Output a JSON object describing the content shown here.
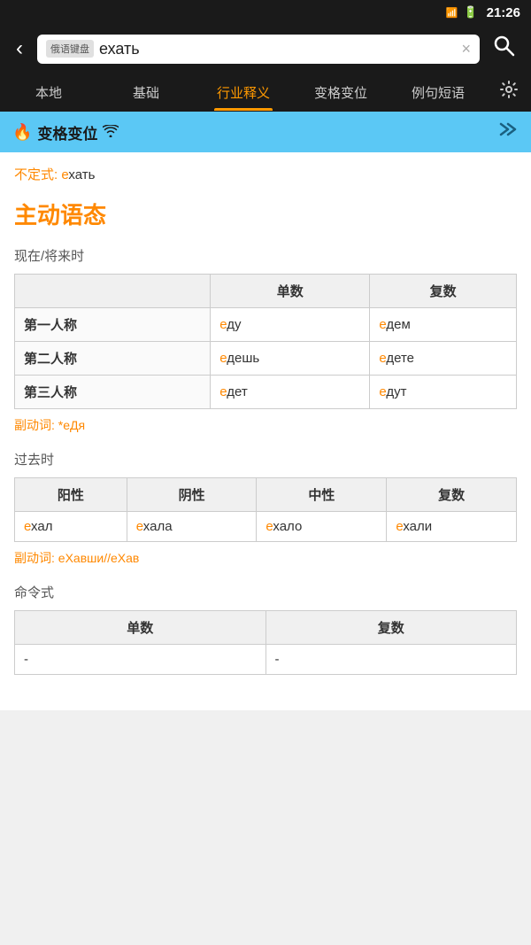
{
  "statusBar": {
    "time": "21:26",
    "signals": "4G/2G"
  },
  "searchBar": {
    "backLabel": "‹",
    "searchTag": "俄语键盘",
    "searchValue": "ехать",
    "clearIcon": "×",
    "searchIcon": "🔍"
  },
  "navTabs": [
    {
      "id": "local",
      "label": "本地",
      "active": false
    },
    {
      "id": "basic",
      "label": "基础",
      "active": false
    },
    {
      "id": "industry",
      "label": "行业释义",
      "active": true
    },
    {
      "id": "conjugation",
      "label": "变格变位",
      "active": false
    },
    {
      "id": "examples",
      "label": "例句短语",
      "active": false
    }
  ],
  "sectionHeader": {
    "title": "变格变位",
    "expandIcon": "≫"
  },
  "content": {
    "infinitiveLabel": "不定式:",
    "infinitiveE": "е",
    "infinitiveRest": "хать",
    "voiceTitle": "主动语态",
    "presentTenseLabel": "现在/将来时",
    "presentTable": {
      "headers": [
        "",
        "单数",
        "复数"
      ],
      "rows": [
        {
          "person": "第一人称",
          "singular": "еду",
          "singularE": "е",
          "singularRest": "ду",
          "plural": "едем",
          "pluralE": "е",
          "pluralRest": "дем"
        },
        {
          "person": "第二人称",
          "singular": "едешь",
          "singularE": "е",
          "singularRest": "дешь",
          "plural": "едете",
          "pluralE": "е",
          "pluralRest": "дете"
        },
        {
          "person": "第三人称",
          "singular": "едет",
          "singularE": "е",
          "singularRest": "дет",
          "plural": "едут",
          "pluralE": "е",
          "pluralRest": "дут"
        }
      ]
    },
    "presentParticiple": "副动词: *еДя",
    "presentParticipleE": "е",
    "pastTenseLabel": "过去时",
    "pastTable": {
      "headers": [
        "阳性",
        "阴性",
        "中性",
        "复数"
      ],
      "rows": [
        {
          "masc": "ехал",
          "mascE": "е",
          "mascRest": "хал",
          "fem": "ехала",
          "femE": "е",
          "femRest": "хала",
          "neut": "ехало",
          "neutE": "е",
          "neutRest": "хало",
          "plur": "ехали",
          "plurE": "е",
          "plurRest": "хали"
        }
      ]
    },
    "pastParticiple": "副动词: еХавши//еХав",
    "pastParticipleE1": "е",
    "pastParticipleE2": "е",
    "imperativeTenseLabel": "命令式",
    "imperativeTable": {
      "headers": [
        "单数",
        "复数"
      ],
      "rows": [
        {
          "singular": "-",
          "plural": "-"
        }
      ]
    }
  }
}
